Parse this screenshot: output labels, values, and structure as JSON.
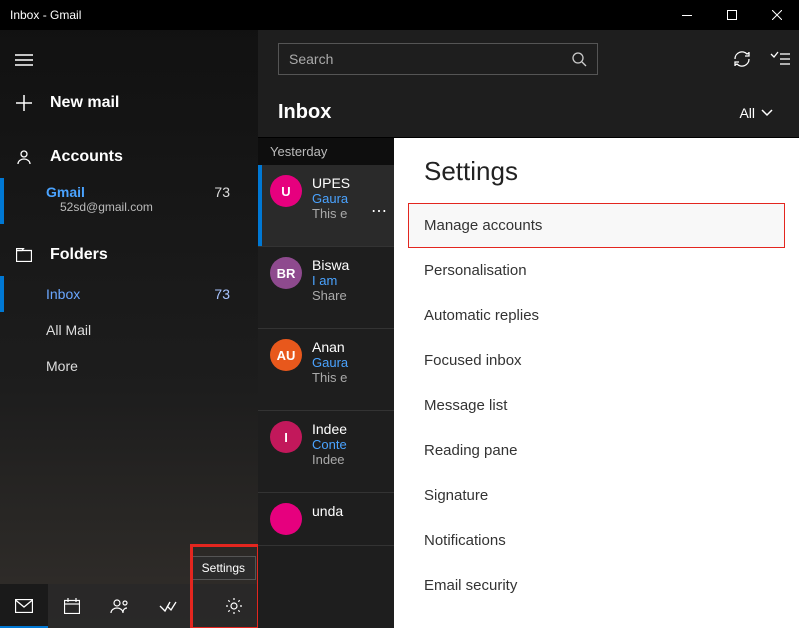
{
  "window": {
    "title": "Inbox - Gmail"
  },
  "sidebar": {
    "new_mail": "New mail",
    "accounts_label": "Accounts",
    "account": {
      "name": "Gmail",
      "email": "52sd@gmail.com",
      "count": "73"
    },
    "folders_label": "Folders",
    "folders": [
      {
        "label": "Inbox",
        "count": "73"
      },
      {
        "label": "All Mail",
        "count": ""
      },
      {
        "label": "More",
        "count": ""
      }
    ],
    "settings_tooltip": "Settings"
  },
  "search": {
    "placeholder": "Search"
  },
  "inbox": {
    "title": "Inbox",
    "filter": "All"
  },
  "messages": {
    "group": "Yesterday",
    "items": [
      {
        "initials": "U",
        "color": "#e6007e",
        "from": "UPES",
        "subject": "Gaura",
        "preview": "This e"
      },
      {
        "initials": "BR",
        "color": "#8e4a8e",
        "from": "Biswa",
        "subject": "I am",
        "preview": "Share"
      },
      {
        "initials": "AU",
        "color": "#e8581c",
        "from": "Anan",
        "subject": "Gaura",
        "preview": "This e"
      },
      {
        "initials": "I",
        "color": "#c2185b",
        "from": "Indee",
        "subject": "Conte",
        "preview": "Indee"
      },
      {
        "initials": "",
        "color": "#e6007e",
        "from": "unda",
        "subject": "",
        "preview": ""
      }
    ]
  },
  "settings": {
    "title": "Settings",
    "items": [
      "Manage accounts",
      "Personalisation",
      "Automatic replies",
      "Focused inbox",
      "Message list",
      "Reading pane",
      "Signature",
      "Notifications",
      "Email security"
    ]
  }
}
